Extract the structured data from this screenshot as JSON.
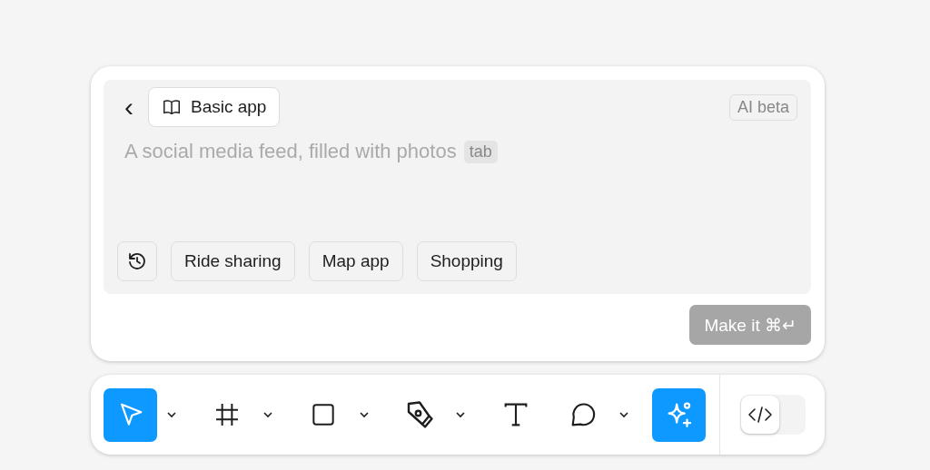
{
  "prompt_card": {
    "back_button": "‹",
    "template": "Basic app",
    "badge": "AI beta",
    "prompt": {
      "placeholder": "A social media feed, filled with photos",
      "key_hint": "tab"
    },
    "suggestions": [
      "Ride sharing",
      "Map app",
      "Shopping"
    ],
    "submit": {
      "label": "Make it ⌘↵",
      "disabled": true
    }
  },
  "toolbar": {
    "tools": [
      {
        "kind": "move",
        "selected": true,
        "dropdown": true
      },
      {
        "kind": "frame",
        "selected": false,
        "dropdown": true
      },
      {
        "kind": "rectangle",
        "selected": false,
        "dropdown": true
      },
      {
        "kind": "pen",
        "selected": false,
        "dropdown": true
      },
      {
        "kind": "text",
        "selected": false,
        "dropdown": false
      },
      {
        "kind": "comment",
        "selected": false,
        "dropdown": true
      },
      {
        "kind": "ai",
        "selected": true,
        "dropdown": false
      }
    ],
    "dev_mode": {
      "on": false
    }
  }
}
